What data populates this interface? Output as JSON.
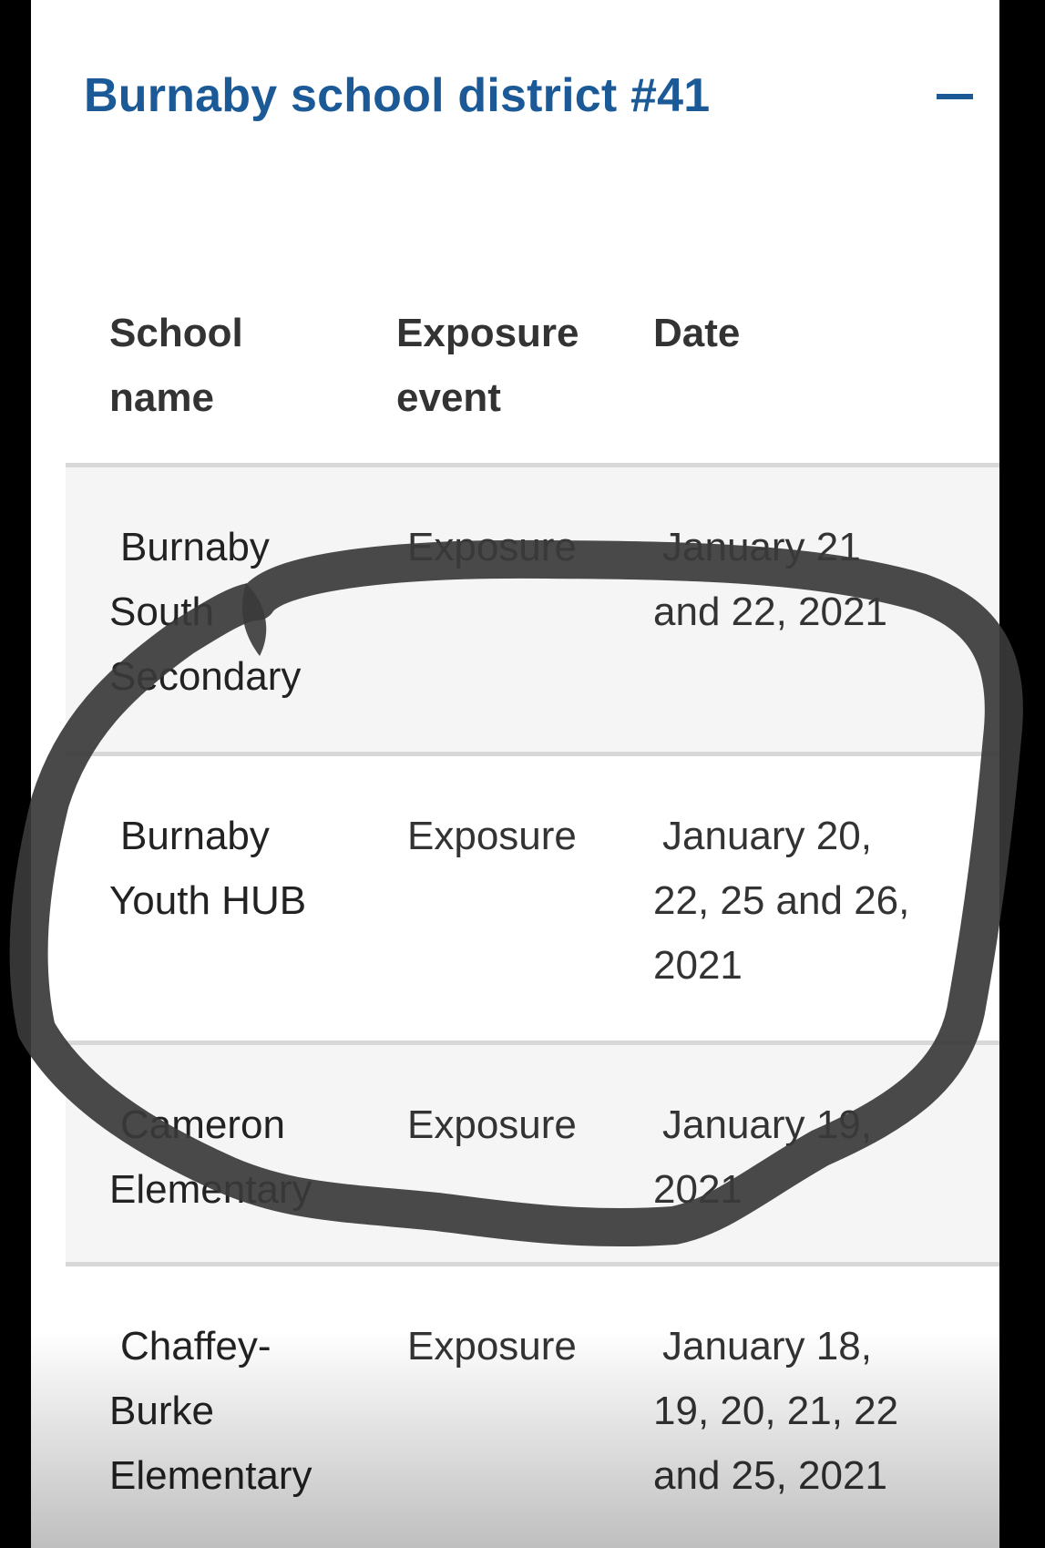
{
  "district": {
    "title": "Burnaby school district #41",
    "collapse_icon": "minus-icon"
  },
  "table": {
    "headers": [
      [
        "School",
        "name"
      ],
      [
        "Exposure",
        "event"
      ],
      [
        "Date"
      ]
    ],
    "rows": [
      {
        "school": [
          "Burnaby",
          "South",
          "Secondary"
        ],
        "event": [
          "Exposure"
        ],
        "date": [
          "January 21",
          "and 22, 2021"
        ]
      },
      {
        "school": [
          "Burnaby",
          "Youth HUB"
        ],
        "event": [
          "Exposure"
        ],
        "date": [
          "January 20,",
          "22, 25 and 26,",
          "2021"
        ]
      },
      {
        "school": [
          "Cameron",
          "Elementary"
        ],
        "event": [
          "Exposure"
        ],
        "date": [
          "January 19,",
          "2021"
        ]
      },
      {
        "school": [
          "Chaffey-",
          "Burke",
          "Elementary"
        ],
        "event": [
          "Exposure"
        ],
        "date": [
          "January 18,",
          "19, 20, 21, 22",
          "and 25, 2021"
        ]
      }
    ]
  },
  "colors": {
    "title": "#1b5a96",
    "row_shade": "#f5f5f5",
    "divider": "#d8d8d8",
    "annotation_stroke": "#3a3a3a"
  }
}
